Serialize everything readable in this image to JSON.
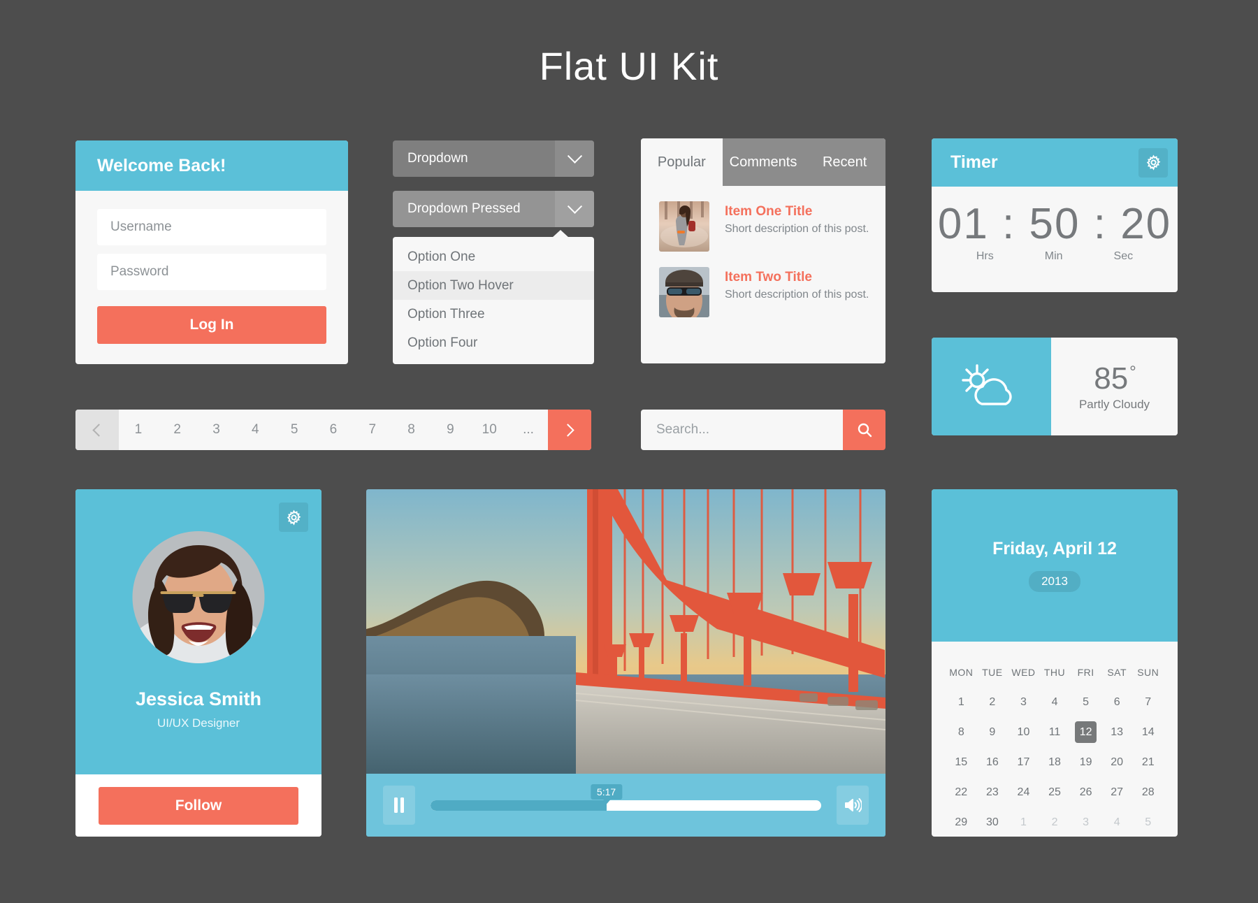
{
  "page": {
    "title": "Flat UI Kit",
    "background": "#4d4d4d"
  },
  "colors": {
    "blue": "#5bc0d8",
    "coral": "#f4705c",
    "gray": "#8c8c8c",
    "card": "#f7f7f7"
  },
  "login": {
    "heading": "Welcome Back!",
    "username_placeholder": "Username",
    "username_value": "",
    "password_placeholder": "Password",
    "password_value": "",
    "submit_label": "Log In"
  },
  "dropdown": {
    "normal_label": "Dropdown",
    "pressed_label": "Dropdown Pressed",
    "chevron_icon": "chevron-down-icon",
    "options": [
      {
        "label": "Option One",
        "state": "normal"
      },
      {
        "label": "Option Two Hover",
        "state": "hover"
      },
      {
        "label": "Option Three",
        "state": "normal"
      },
      {
        "label": "Option Four",
        "state": "normal"
      }
    ]
  },
  "tabs_card": {
    "tabs": [
      {
        "label": "Popular",
        "active": true
      },
      {
        "label": "Comments",
        "active": false
      },
      {
        "label": "Recent",
        "active": false
      }
    ],
    "posts": [
      {
        "title": "Item One Title",
        "description": "Short description  of this post.",
        "thumb": "beach-photo-thumbnail"
      },
      {
        "title": "Item Two Title",
        "description": "Short description  of this post.",
        "thumb": "man-sunglasses-thumbnail"
      }
    ]
  },
  "timer": {
    "title": "Timer",
    "gear_icon": "gear-icon",
    "hours": "01",
    "separator": ":",
    "minutes": "50",
    "seconds": "20",
    "labels": {
      "hours": "Hrs",
      "minutes": "Min",
      "seconds": "Sec"
    }
  },
  "weather": {
    "icon": "sun-behind-cloud-icon",
    "temperature": "85",
    "degree": "°",
    "condition": "Partly Cloudy"
  },
  "pagination": {
    "prev_icon": "chevron-left-icon",
    "next_icon": "chevron-right-icon",
    "pages": [
      "1",
      "2",
      "3",
      "4",
      "5",
      "6",
      "7",
      "8",
      "9",
      "10",
      "..."
    ]
  },
  "search": {
    "placeholder": "Search...",
    "value": "",
    "icon": "search-icon"
  },
  "profile": {
    "gear_icon": "gear-icon",
    "avatar": "woman-sunglasses-avatar",
    "name": "Jessica Smith",
    "role": "UI/UX Designer",
    "follow_label": "Follow"
  },
  "video": {
    "image": "golden-gate-bridge-photo",
    "play_state_icon": "pause-icon",
    "volume_icon": "volume-up-icon",
    "current_time": "5:17",
    "progress_percent": 45
  },
  "calendar": {
    "date_label": "Friday, April 12",
    "year": "2013",
    "weekdays": [
      "MON",
      "TUE",
      "WED",
      "THU",
      "FRI",
      "SAT",
      "SUN"
    ],
    "weeks": [
      [
        {
          "d": "1"
        },
        {
          "d": "2"
        },
        {
          "d": "3"
        },
        {
          "d": "4"
        },
        {
          "d": "5"
        },
        {
          "d": "6"
        },
        {
          "d": "7"
        }
      ],
      [
        {
          "d": "8"
        },
        {
          "d": "9"
        },
        {
          "d": "10"
        },
        {
          "d": "11"
        },
        {
          "d": "12",
          "selected": true
        },
        {
          "d": "13"
        },
        {
          "d": "14"
        }
      ],
      [
        {
          "d": "15"
        },
        {
          "d": "16"
        },
        {
          "d": "17"
        },
        {
          "d": "18"
        },
        {
          "d": "19"
        },
        {
          "d": "20"
        },
        {
          "d": "21"
        }
      ],
      [
        {
          "d": "22"
        },
        {
          "d": "23"
        },
        {
          "d": "24"
        },
        {
          "d": "25"
        },
        {
          "d": "26"
        },
        {
          "d": "27"
        },
        {
          "d": "28"
        }
      ],
      [
        {
          "d": "29"
        },
        {
          "d": "30"
        },
        {
          "d": "1",
          "muted": true
        },
        {
          "d": "2",
          "muted": true
        },
        {
          "d": "3",
          "muted": true
        },
        {
          "d": "4",
          "muted": true
        },
        {
          "d": "5",
          "muted": true
        }
      ]
    ]
  }
}
